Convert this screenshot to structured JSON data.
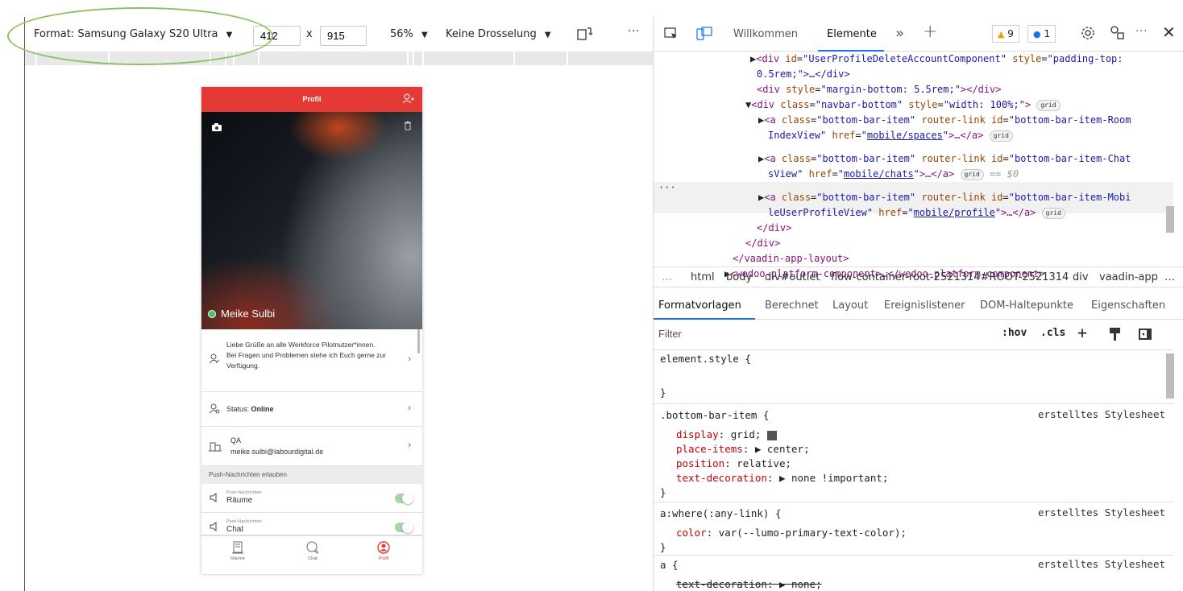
{
  "emulation": {
    "format_label": "Format: Samsung Galaxy S20 Ultra",
    "width_value": "412",
    "height_value": "915",
    "times": "x",
    "zoom": "56%",
    "throttling": "Keine Drosselung",
    "more": "···"
  },
  "phone": {
    "header_title": "Profil",
    "user_name": "Meike Sulbi",
    "bio": "Liebe Grüße an alle Werkforce Pilotnutzer*innen.\nBei Fragen und Problemen stehe ich Euch gerne zur Verfügung.",
    "status_label": "Status:",
    "status_value": "Online",
    "company_name": "QA",
    "company_email": "meike.sulbi@labourdigital.de",
    "push_section": "Push-Nachrichten erlauben",
    "toggles": [
      {
        "small": "Push-Nachrichten",
        "label": "Räume",
        "on": true
      },
      {
        "small": "Push-Nachrichten",
        "label": "Chat",
        "on": true
      }
    ],
    "nav": [
      {
        "label": "Räume",
        "icon": "building-icon",
        "active": false
      },
      {
        "label": "Chat",
        "icon": "chat-icon",
        "active": false
      },
      {
        "label": "Profil",
        "icon": "profile-icon",
        "active": true
      }
    ],
    "accent": "#e53935"
  },
  "devtools": {
    "tabs": {
      "welcome": "Willkommen",
      "elements": "Elemente",
      "more_tabs": "»",
      "add": "+"
    },
    "warnings": "9",
    "messages": "1",
    "dom": {
      "line1_tag": "div",
      "line1_id": "UserProfileDeleteAccountComponent",
      "line1_style": "padding-top:",
      "line1b": "0.5rem;\">…</div>",
      "line2_style": "margin-bottom: 5.5rem;",
      "line3_class": "navbar-bottom",
      "line3_style": "width: 100%;",
      "grid": "grid",
      "a1_id": "bottom-bar-item-Room",
      "a1_id_cont": "IndexView",
      "a1_href": "mobile/spaces",
      "a2_id": "bottom-bar-item-Chat",
      "a2_id_cont": "sView",
      "a2_href": "mobile/chats",
      "a2_eq": "== $0",
      "a3_id": "bottom-bar-item-Mobi",
      "a3_id_cont": "leUserProfileView",
      "a3_href": "mobile/profile",
      "close_div": "</div>",
      "close_layout": "</vaadin-app-layout>",
      "wedoo": "<wedoo-platform-component>…</wedoo-platform-component>"
    },
    "breadcrumbs": [
      "html",
      "body",
      "div#outlet",
      "flow-container-root-2521314#ROOT-2521314",
      "div",
      "vaadin-app"
    ],
    "style_tabs": [
      "Formatvorlagen",
      "Berechnet",
      "Layout",
      "Ereignislistener",
      "DOM-Haltepunkte",
      "Eigenschaften"
    ],
    "filter_placeholder": "Filter",
    "hov": ":hov",
    "cls": ".cls",
    "rules": {
      "element_style": "element.style {",
      "close": "}",
      "r1_selector": ".bottom-bar-item {",
      "r1_source": "erstelltes Stylesheet",
      "r1_p1": "display",
      "r1_v1": "grid;",
      "r1_p2": "place-items",
      "r1_v2": "▶ center;",
      "r1_p3": "position",
      "r1_v3": "relative;",
      "r1_p4": "text-decoration",
      "r1_v4": "▶ none !important;",
      "r2_selector": "a:where(:any-link) {",
      "r2_source": "erstelltes Stylesheet",
      "r2_p1": "color",
      "r2_v1": "var(--lumo-primary-text-color);",
      "r3_selector": "a {",
      "r3_source": "erstelltes Stylesheet",
      "r3_p1": "text-decoration",
      "r3_v1": "▶ none;"
    }
  }
}
